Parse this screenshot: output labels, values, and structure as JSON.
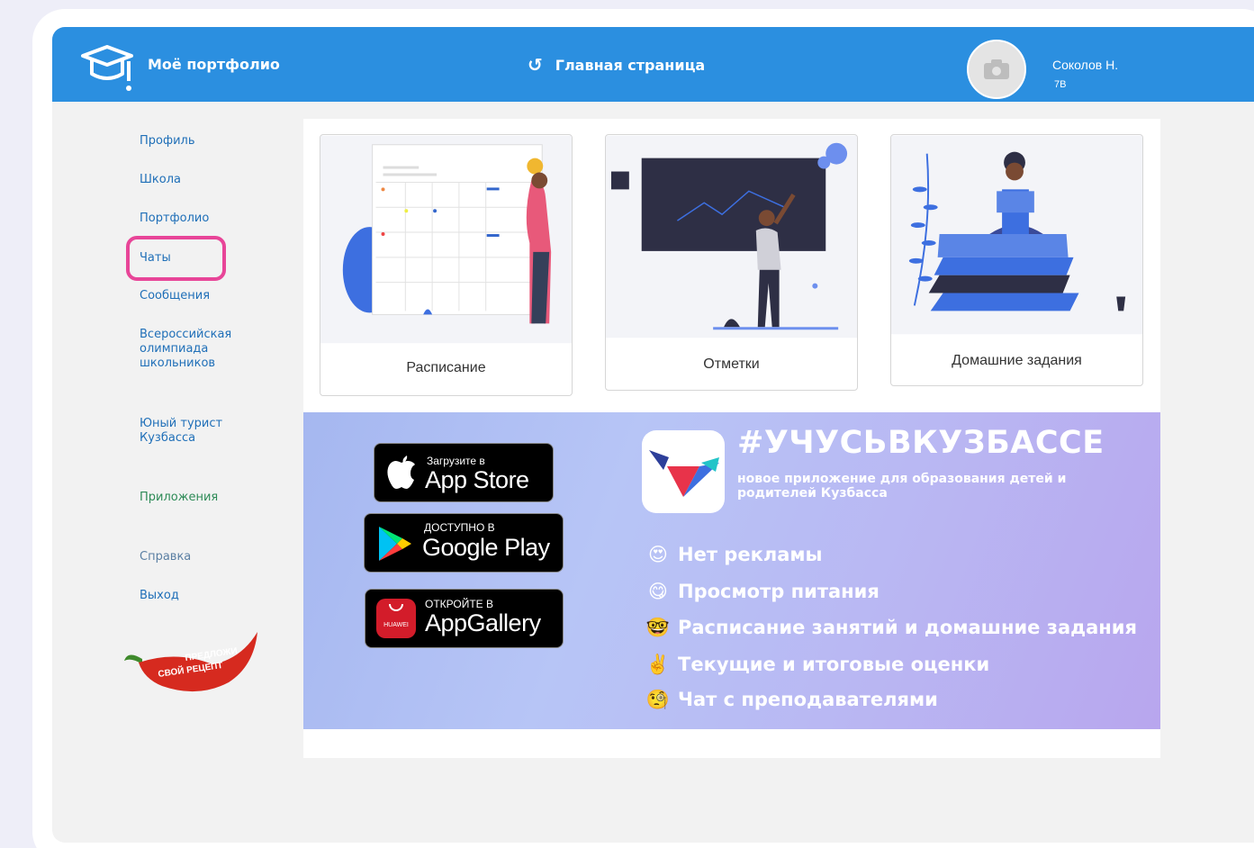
{
  "header": {
    "app_title": "Моё портфолио",
    "home_link": "Главная страница",
    "user_name": "Соколов Н.",
    "user_class": "7В"
  },
  "sidebar": {
    "items": [
      {
        "label": "Профиль"
      },
      {
        "label": "Школа"
      },
      {
        "label": "Портфолио"
      },
      {
        "label": "Чаты"
      },
      {
        "label": "Сообщения"
      },
      {
        "label": "Всероссийская\nолимпиада\nшкольников"
      },
      {
        "label": "Юный турист\nКузбасса"
      },
      {
        "label": "Приложения"
      },
      {
        "label": "Справка"
      },
      {
        "label": "Выход"
      }
    ],
    "promo_text": [
      "ПРЕДЛОЖИ",
      "СВОЙ РЕЦЕПТ"
    ]
  },
  "cards": [
    {
      "label": "Расписание"
    },
    {
      "label": "Отметки"
    },
    {
      "label": "Домашние задания"
    }
  ],
  "banner": {
    "appstore": {
      "small": "Загрузите в",
      "big": "App Store"
    },
    "googleplay": {
      "small": "ДОСТУПНО В",
      "big": "Google Play"
    },
    "appgallery": {
      "small": "ОТКРОЙТЕ В",
      "big": "AppGallery",
      "brand": "HUAWEI"
    },
    "hashtag": "#УЧУСЬВКУЗБАССЕ",
    "tagline": "новое приложение для образования детей и родителей Кузбасса",
    "features": [
      {
        "emoji": "😍",
        "text": "Нет рекламы"
      },
      {
        "emoji": "😋",
        "text": "Просмотр питания"
      },
      {
        "emoji": "🤓",
        "text": "Расписание занятий и домашние задания"
      },
      {
        "emoji": "✌️",
        "text": "Текущие и итоговые оценки"
      },
      {
        "emoji": "🧐",
        "text": "Чат с преподавателями"
      }
    ]
  },
  "colors": {
    "header_bg": "#2b8fe0",
    "highlight": "#e84598",
    "link": "#1f6fb8"
  }
}
